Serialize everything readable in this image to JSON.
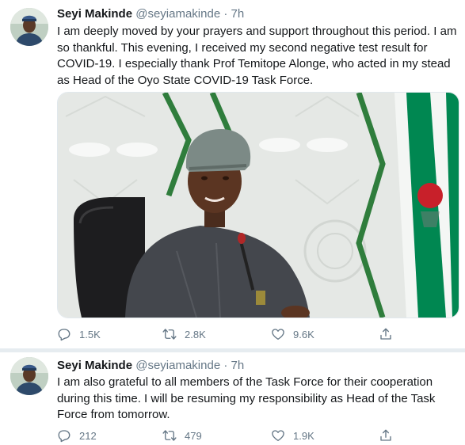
{
  "tweets": [
    {
      "author_name": "Seyi Makinde",
      "author_handle": "@seyiamakinde",
      "separator": "·",
      "time": "7h",
      "text": "I am deeply moved by your prayers and support throughout this period. I am so thankful. This evening, I received my second negative test result for COVID-19. I especially thank Prof Temitope Alonge, who acted in my stead as Head of the Oyo State COVID-19 Task Force.",
      "replies": "1.5K",
      "retweets": "2.8K",
      "likes": "9.6K"
    },
    {
      "author_name": "Seyi Makinde",
      "author_handle": "@seyiamakinde",
      "separator": "·",
      "time": "7h",
      "text": "I am also grateful to all members of the Task Force for their cooperation during this time. I will be resuming my responsibility as Head of the Task Force from tomorrow.",
      "replies": "212",
      "retweets": "479",
      "likes": "1.9K"
    }
  ],
  "icons": {
    "reply": "reply-icon",
    "retweet": "retweet-icon",
    "like": "heart-icon",
    "share": "share-icon"
  },
  "colors": {
    "secondary_text": "#657786",
    "thread_line": "#ccd6dd",
    "separator": "#e6ecf0",
    "flag_green": "#008751"
  }
}
